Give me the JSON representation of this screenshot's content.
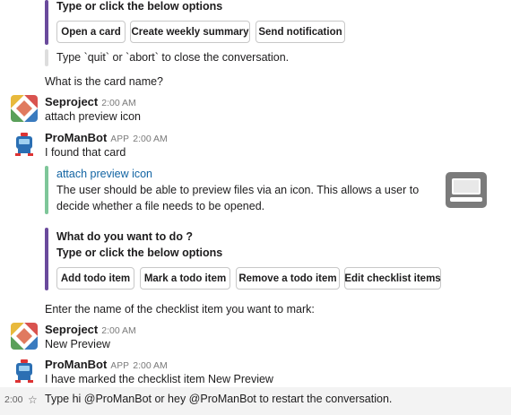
{
  "block1": {
    "heading": "Type or click the below options",
    "buttons": [
      "Open a card",
      "Create weekly summary",
      "Send notification"
    ],
    "note": "Type `quit` or `abort` to close the conversation."
  },
  "question1": "What is the card name?",
  "msg1": {
    "user": "Seproject",
    "time": "2:00 AM",
    "text": "attach preview icon"
  },
  "msg2": {
    "user": "ProManBot",
    "badge": "APP",
    "time": "2:00 AM",
    "text": "I found that card",
    "card": {
      "title": "attach preview icon",
      "desc_line1": "The user should be able to preview files via an icon. This allows a user to",
      "desc_line2": "decide whether a file needs to be opened."
    },
    "prompt": {
      "heading1": "What do you want to do ?",
      "heading2": "Type or click the below options",
      "buttons": [
        "Add todo item",
        "Mark a todo item",
        "Remove a todo item",
        "Edit checklist items"
      ]
    },
    "question": "Enter the name of the checklist item you want to mark:"
  },
  "msg3": {
    "user": "Seproject",
    "time": "2:00 AM",
    "text": "New Preview"
  },
  "msg4": {
    "user": "ProManBot",
    "badge": "APP",
    "time": "2:00 AM",
    "text1": "I have marked the checklist item New Preview",
    "text2": "Type hi @ProManBot or hey @ProManBot to restart the conversation.",
    "hover_time": "2:00"
  },
  "icons": [
    "seproject-avatar-icon",
    "promanbot-avatar-icon",
    "laptop-preview-icon",
    "star-icon"
  ]
}
